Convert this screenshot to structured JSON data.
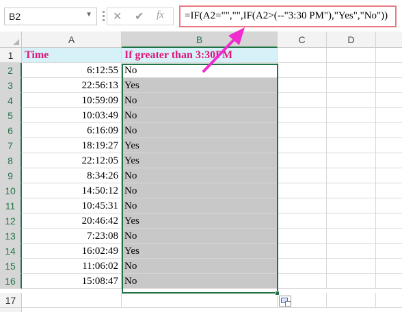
{
  "formula_bar": {
    "name_box": "B2",
    "cancel_glyph": "✕",
    "enter_glyph": "✔",
    "fx_label": "fx",
    "formula": "=IF(A2=\"\",\"\",IF(A2>(--\"3:30 PM\"),\"Yes\",\"No\"))"
  },
  "columns": [
    "A",
    "B",
    "C",
    "D"
  ],
  "header_row": {
    "row": "1",
    "a": "Time",
    "b": "If greater than 3:30PM"
  },
  "rows": [
    {
      "row": "2",
      "time": "6:12:55",
      "result": "No"
    },
    {
      "row": "3",
      "time": "22:56:13",
      "result": "Yes"
    },
    {
      "row": "4",
      "time": "10:59:09",
      "result": "No"
    },
    {
      "row": "5",
      "time": "10:03:49",
      "result": "No"
    },
    {
      "row": "6",
      "time": "6:16:09",
      "result": "No"
    },
    {
      "row": "7",
      "time": "18:19:27",
      "result": "Yes"
    },
    {
      "row": "8",
      "time": "22:12:05",
      "result": "Yes"
    },
    {
      "row": "9",
      "time": "8:34:26",
      "result": "No"
    },
    {
      "row": "10",
      "time": "14:50:12",
      "result": "No"
    },
    {
      "row": "11",
      "time": "10:45:31",
      "result": "No"
    },
    {
      "row": "12",
      "time": "20:46:42",
      "result": "Yes"
    },
    {
      "row": "13",
      "time": "7:23:08",
      "result": "No"
    },
    {
      "row": "14",
      "time": "16:02:49",
      "result": "Yes"
    },
    {
      "row": "15",
      "time": "11:06:02",
      "result": "No"
    },
    {
      "row": "16",
      "time": "15:08:47",
      "result": "No"
    }
  ],
  "last_row": "17",
  "colors": {
    "header_text": "#e0157a",
    "header_fill": "#d6f2f8",
    "selection": "#217346",
    "annotation_arrow": "#f02bd0",
    "formula_border": "#e87b82"
  },
  "icons": {
    "quick_analysis": "quick-analysis-icon",
    "arrow": "annotation-arrow"
  }
}
